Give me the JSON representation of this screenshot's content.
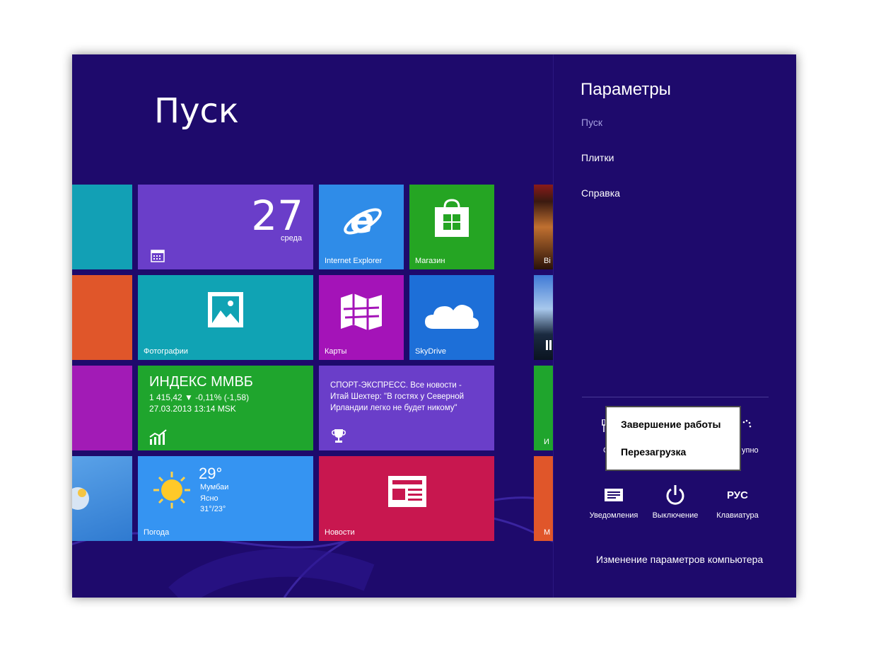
{
  "start": {
    "title": "Пуск"
  },
  "tiles": {
    "calendar": {
      "day": "27",
      "weekday": "среда"
    },
    "ie": {
      "label": "Internet Explorer"
    },
    "store": {
      "label": "Магазин"
    },
    "photos": {
      "label": "Фотографии"
    },
    "maps": {
      "label": "Карты"
    },
    "skydrive": {
      "label": "SkyDrive"
    },
    "finance": {
      "title": "ИНДЕКС ММВБ",
      "line1": "1 415,42  ▼ -0,11% (-1,58)",
      "line2": "27.03.2013 13:14 MSK"
    },
    "sport": {
      "text": "СПОРТ-ЭКСПРЕСС. Все новости - Итай Шехтер: \"В гостях у Северной Ирландии легко не будет никому\""
    },
    "weather": {
      "temp": "29°",
      "city": "Мумбаи",
      "condition": "Ясно",
      "range": "31°/23°",
      "label": "Погода"
    },
    "news": {
      "label": "Новости"
    },
    "partial": {
      "b": "Bi",
      "i": "И",
      "m": "М"
    }
  },
  "charm": {
    "title": "Параметры",
    "links": [
      "Пуск",
      "Плитки",
      "Справка"
    ],
    "partial_left": "С",
    "partial_right": "упно",
    "buttons": {
      "notifications": "Уведомления",
      "power": "Выключение",
      "keyboard": "Клавиатура",
      "keyboard_glyph": "РУС"
    },
    "footer": "Изменение параметров компьютера"
  },
  "power_menu": {
    "items": [
      "Завершение работы",
      "Перезагрузка"
    ]
  },
  "colors": {
    "background": "#1e0a6c",
    "calendar": "#6a3ec9",
    "ie": "#2f8ce8",
    "store": "#25a523",
    "photos": "#10a3b4",
    "maps": "#a413b8",
    "skydrive": "#1d6fd8",
    "finance": "#1fa52d",
    "sport": "#6a3ec9",
    "weather": "#3594f2",
    "news": "#c8174f"
  }
}
